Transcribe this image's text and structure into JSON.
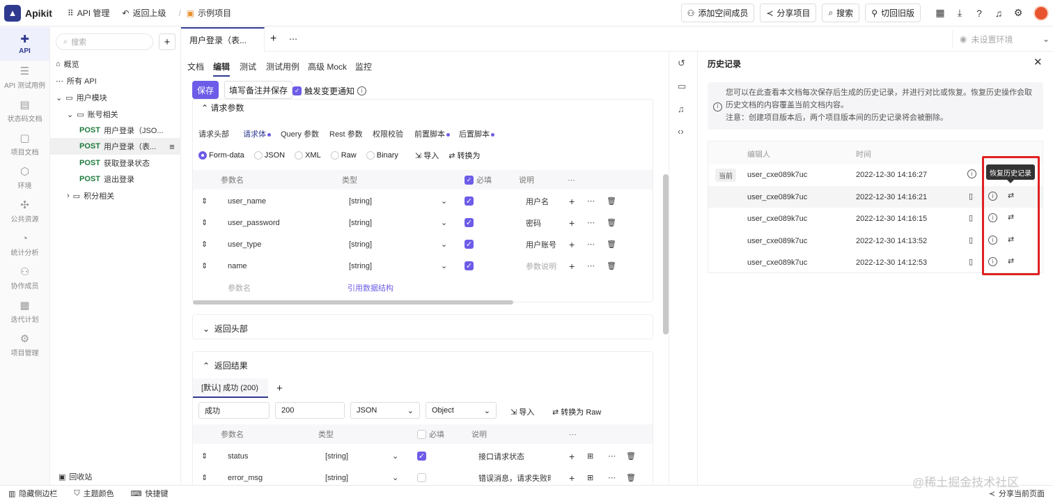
{
  "topbar": {
    "brand": "Apikit",
    "api_manage": "API 管理",
    "back": "返回上级",
    "project": "示例项目",
    "add_member": "添加空间成员",
    "share_project": "分享项目",
    "search": "搜索",
    "switch_old": "切回旧版"
  },
  "rail": [
    {
      "label": "API",
      "icon": "api-icon"
    },
    {
      "label": "API 测试用例",
      "icon": "test-case-icon"
    },
    {
      "label": "状态码文档",
      "icon": "status-code-icon"
    },
    {
      "label": "项目文档",
      "icon": "doc-icon"
    },
    {
      "label": "环境",
      "icon": "env-icon"
    },
    {
      "label": "公共资源",
      "icon": "puzzle-icon"
    },
    {
      "label": "统计分析",
      "icon": "stats-icon"
    },
    {
      "label": "协作成员",
      "icon": "members-icon"
    },
    {
      "label": "迭代计划",
      "icon": "calendar-icon"
    },
    {
      "label": "项目管理",
      "icon": "settings-icon"
    }
  ],
  "tree": {
    "search_placeholder": "搜索",
    "overview": "概览",
    "all_api": "所有 API",
    "user_module": "用户模块",
    "account": "账号相关",
    "apis": [
      {
        "method": "POST",
        "name": "用户登录（JSO..."
      },
      {
        "method": "POST",
        "name": "用户登录（表..."
      },
      {
        "method": "POST",
        "name": "获取登录状态"
      },
      {
        "method": "POST",
        "name": "退出登录"
      }
    ],
    "points": "积分相关",
    "recycle": "回收站"
  },
  "tabs": {
    "doc_tab": "用户登录（表...",
    "env": "未设置环境"
  },
  "subtabs": [
    "文档",
    "编辑",
    "测试",
    "测试用例",
    "高级 Mock",
    "监控"
  ],
  "actions": {
    "save": "保存",
    "save_with_note": "填写备注并保存",
    "notify": "触发变更通知"
  },
  "request": {
    "section": "请求参数",
    "tabs": [
      "请求头部",
      "请求体",
      "Query 参数",
      "Rest 参数",
      "权限校验",
      "前置脚本",
      "后置脚本"
    ],
    "body_types": [
      "Form-data",
      "JSON",
      "XML",
      "Raw",
      "Binary"
    ],
    "import": "导入",
    "convert": "转换为",
    "columns": {
      "name": "参数名",
      "type": "类型",
      "required": "必填",
      "desc": "说明"
    },
    "rows": [
      {
        "name": "user_name",
        "type": "[string]",
        "desc": "用户名"
      },
      {
        "name": "user_password",
        "type": "[string]",
        "desc": "密码"
      },
      {
        "name": "user_type",
        "type": "[string]",
        "desc": "用户账号"
      },
      {
        "name": "name",
        "type": "[string]",
        "desc": "参数说明"
      }
    ],
    "new_param_placeholder": "参数名",
    "ref_struct": "引用数据结构"
  },
  "response_header": "返回头部",
  "response": {
    "section": "返回结果",
    "tab": "[默认] 成功 (200)",
    "name_value": "成功",
    "code_value": "200",
    "format": "JSON",
    "root_type": "Object",
    "import": "导入",
    "convert": "转换为 Raw",
    "columns": {
      "name": "参数名",
      "type": "类型",
      "required": "必填",
      "desc": "说明"
    },
    "rows": [
      {
        "name": "status",
        "type": "[string]",
        "required": true,
        "desc": "接口请求状态"
      },
      {
        "name": "error_msg",
        "type": "[string]",
        "required": false,
        "desc": "错误消息，请求失败时"
      }
    ]
  },
  "history": {
    "title": "历史记录",
    "info_1": "您可以在此查看本文档每次保存后生成的历史记录，并进行对比或恢复。恢复历史操作会取",
    "info_2": "历史文档的内容覆盖当前文档内容。",
    "info_3": "注意：创建项目版本后，两个项目版本间的历史记录将会被删除。",
    "col_editor": "编辑人",
    "col_time": "时间",
    "current_badge": "当前",
    "records": [
      {
        "editor": "user_cxe089k7uc",
        "time": "2022-12-30 14:16:27"
      },
      {
        "editor": "user_cxe089k7uc",
        "time": "2022-12-30 14:16:21"
      },
      {
        "editor": "user_cxe089k7uc",
        "time": "2022-12-30 14:16:15"
      },
      {
        "editor": "user_cxe089k7uc",
        "time": "2022-12-30 14:13:52"
      },
      {
        "editor": "user_cxe089k7uc",
        "time": "2022-12-30 14:12:53"
      }
    ],
    "tooltip": "恢复历史记录"
  },
  "bottombar": {
    "hide_sidebar": "隐藏侧边栏",
    "theme": "主题颜色",
    "shortcuts": "快捷键",
    "share_page": "分享当前页面"
  },
  "watermark": "@稀土掘金技术社区"
}
